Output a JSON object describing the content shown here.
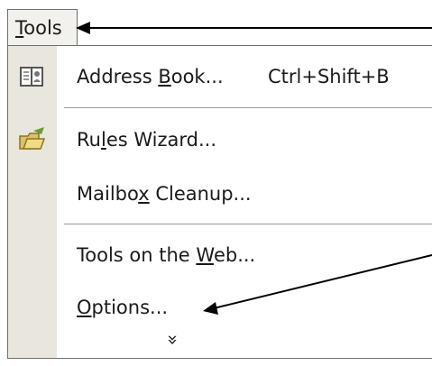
{
  "menu_title": {
    "before": "",
    "mnemonic": "T",
    "after": "ools"
  },
  "items": [
    {
      "before": "Address ",
      "mnemonic": "B",
      "after": "ook...",
      "shortcut": "Ctrl+Shift+B",
      "icon": "address-book-icon"
    },
    {
      "before": "Ru",
      "mnemonic": "l",
      "after": "es Wizard...",
      "icon": "rules-wizard-icon"
    },
    {
      "before": "Mailbo",
      "mnemonic": "x",
      "after": " Cleanup..."
    },
    {
      "before": "Tools on the ",
      "mnemonic": "W",
      "after": "eb..."
    },
    {
      "before": "",
      "mnemonic": "O",
      "after": "ptions..."
    }
  ],
  "expand_glyph": "»",
  "colors": {
    "icon_strip": "#e9e6dd",
    "menu_border": "#6f6f6f",
    "tab_bg": "#f2f1ed"
  }
}
